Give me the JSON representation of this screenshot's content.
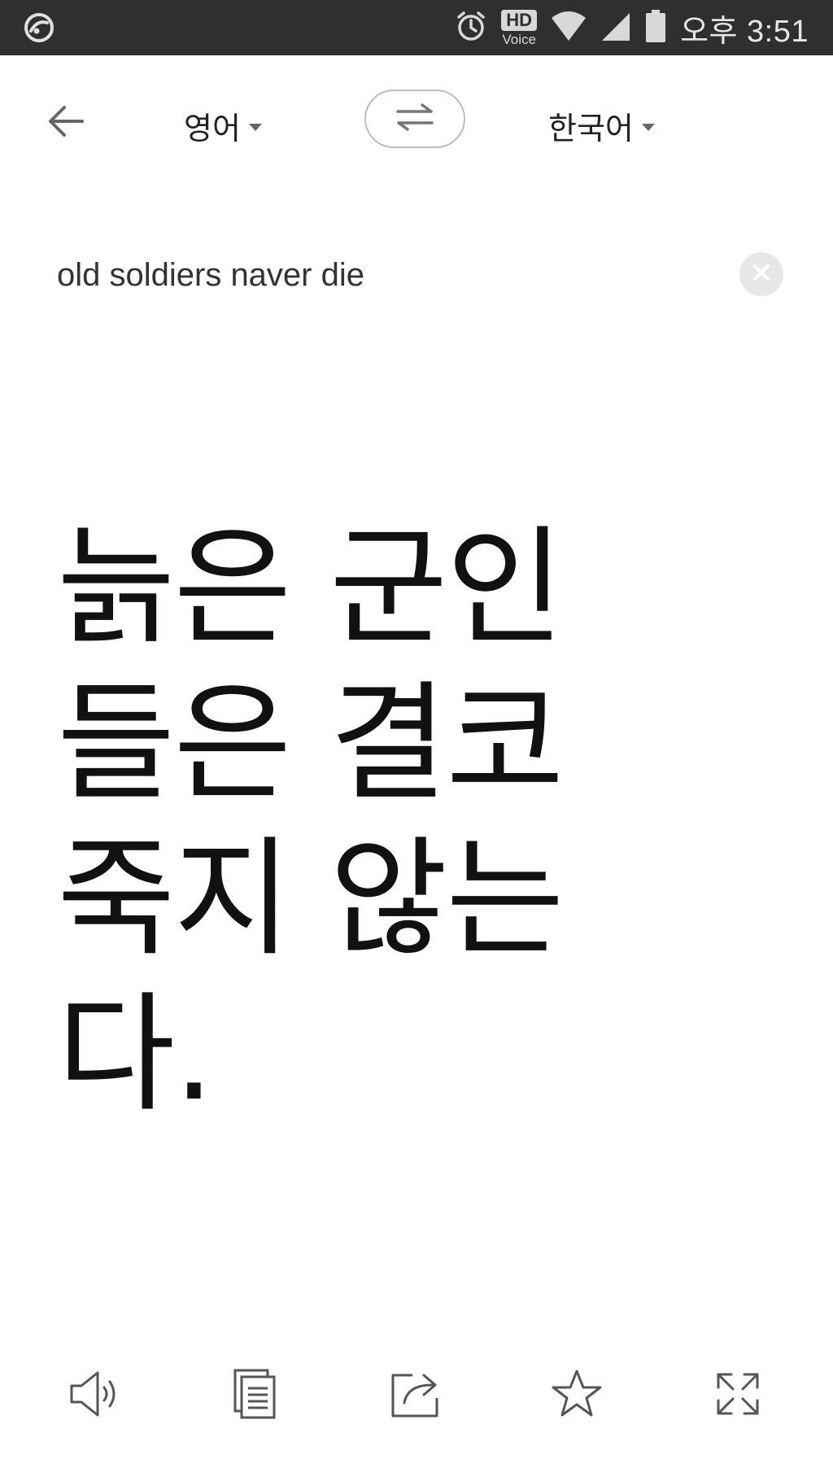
{
  "status_bar": {
    "time": "오후 3:51",
    "hd_label": "HD",
    "voice_label": "Voice",
    "icons": [
      "app-notification-icon",
      "alarm-icon",
      "hd-voice-icon",
      "wifi-icon",
      "cell-signal-icon",
      "battery-icon"
    ]
  },
  "header": {
    "source_language": "영어",
    "target_language": "한국어",
    "icons": [
      "back-arrow-icon",
      "dropdown-caret-icon",
      "swap-languages-icon"
    ]
  },
  "input": {
    "text": "old soldiers naver die",
    "icons": [
      "clear-icon"
    ]
  },
  "result": {
    "text": "늙은 군인들은 결코 죽지 않는다."
  },
  "toolbar": {
    "icons": [
      "speaker-icon",
      "copy-icon",
      "share-icon",
      "star-icon",
      "expand-icon"
    ]
  },
  "colors": {
    "status_bar_bg": "#2e302f",
    "text_primary": "#111111",
    "icon_gray": "#555555",
    "border_gray": "#bdbdbd"
  }
}
